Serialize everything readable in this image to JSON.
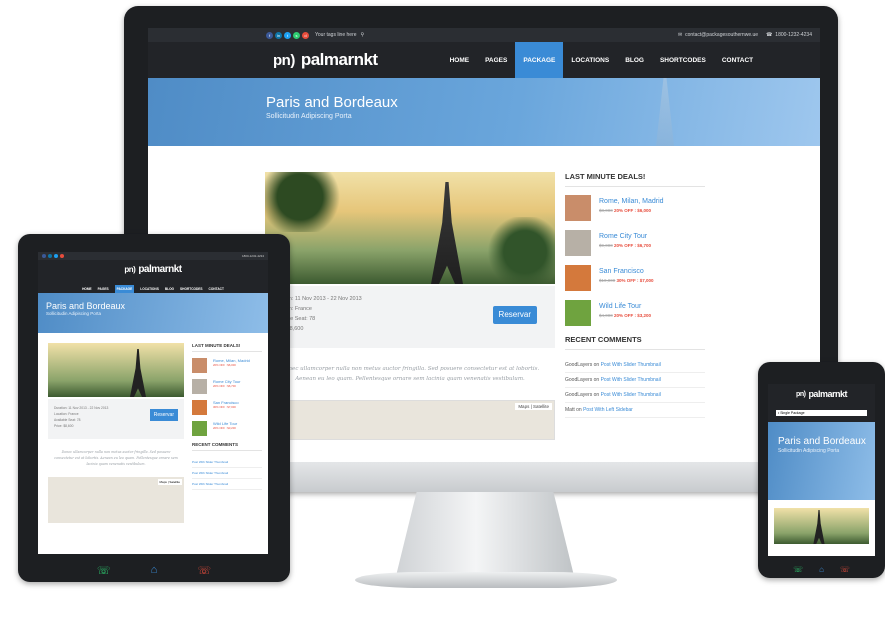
{
  "site": {
    "logo_mark": "pn)",
    "logo_text": "palmarnkt",
    "tagline": "Your tags line here",
    "email": "contact@packagesouthernwe.ue",
    "phone": "1800-1232-4234"
  },
  "nav": [
    "HOME",
    "PAGES",
    "PACKAGE",
    "LOCATIONS",
    "BLOG",
    "SHORTCODES",
    "CONTACT"
  ],
  "nav_active": "PACKAGE",
  "banner": {
    "title": "Paris and Bordeaux",
    "subtitle": "Sollicitudin Adipiscing Porta"
  },
  "package": {
    "duration": "Duration: 11 Nov 2013 - 22 Nov 2013",
    "location": "Location: France",
    "seats": "Available Seat: 78",
    "price": "Price: $8,600",
    "button": "Reservar",
    "quote": "Donec ullamcorper nulla non metus auctor fringilla. Sed posuere consectetur est at lobortis. Aenean eu leo quam. Pellentesque ornare sem lacinia quam venenatis vestibulum.",
    "map_tabs": "Maps | Satellite"
  },
  "sidebar": {
    "deals_title": "LAST MINUTE DEALS!",
    "deals": [
      {
        "name": "Rome, Milan, Madrid",
        "old": "$8,000",
        "off": "20% OFF : $6,000",
        "color": "#c98d6a"
      },
      {
        "name": "Rome City Tour",
        "old": "$9,000",
        "off": "20% OFF : $6,700",
        "color": "#b7b0a6"
      },
      {
        "name": "San Francisco",
        "old": "$10,000",
        "off": "30% OFF : $7,000",
        "color": "#d4793c"
      },
      {
        "name": "Wild Life Tour",
        "old": "$4,000",
        "off": "20% OFF : $3,200",
        "color": "#6fa33f"
      }
    ],
    "comments_title": "RECENT COMMENTS",
    "comments": [
      {
        "author": "GoodLayers on ",
        "link": "Post With Slider Thumbnail"
      },
      {
        "author": "GoodLayers on ",
        "link": "Post With Slider Thumbnail"
      },
      {
        "author": "GoodLayers on ",
        "link": "Post With Slider Thumbnail"
      },
      {
        "author": "Matt on ",
        "link": "Post With Left Sidebar"
      }
    ]
  },
  "phone": {
    "select": "• Single Package"
  }
}
